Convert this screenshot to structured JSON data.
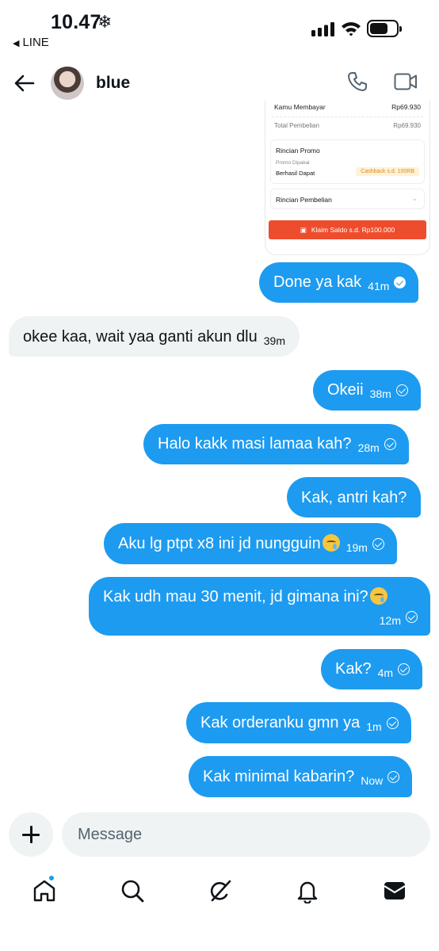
{
  "status_bar": {
    "time": "10.47",
    "weather_glyph": "❄",
    "back_app": "LINE",
    "back_glyph": "◀"
  },
  "header": {
    "username": "blue",
    "icons": [
      "back-arrow-icon",
      "avatar",
      "phone-icon",
      "video-icon"
    ]
  },
  "receipt": {
    "paid_label": "Kamu Membayar",
    "paid_value": "Rp69.930",
    "total_label": "Total Pembelian",
    "total_value": "Rp69.930",
    "promo_title": "Rincian Promo",
    "promo_used": "Promo Dipakai",
    "promo_got": "Berhasil Dapat",
    "promo_badge": "Cashback s.d. 100RB",
    "purchase_details": "Rincian Pembelian",
    "cta": "Klaim Saldo s.d. Rp100.000",
    "accent": "#ee4d2d"
  },
  "messages": [
    {
      "dir": "out",
      "text": "Done ya kak",
      "time": "41m",
      "status": "seen"
    },
    {
      "dir": "in",
      "text": "okee kaa, wait yaa ganti akun dlu",
      "time": "39m"
    },
    {
      "dir": "out",
      "text": "Okeii",
      "time": "38m",
      "status": "sent"
    },
    {
      "dir": "out",
      "text": "Halo kakk masi lamaa kah?",
      "time": "28m",
      "status": "sent"
    },
    {
      "dir": "out",
      "text": "Kak, antri kah?",
      "time": "",
      "status": ""
    },
    {
      "dir": "out",
      "text": "Aku lg ptpt x8 ini jd nungguin",
      "emoji": "face-holding-back-tears",
      "time": "19m",
      "status": "sent"
    },
    {
      "dir": "out",
      "text": "Kak udh mau 30 menit, jd gimana ini?",
      "emoji": "face-holding-back-tears",
      "time": "12m",
      "status": "sent"
    },
    {
      "dir": "out",
      "text": "Kak?",
      "time": "4m",
      "status": "sent"
    },
    {
      "dir": "out",
      "text": "Kak orderanku gmn ya",
      "time": "1m",
      "status": "sent"
    },
    {
      "dir": "out",
      "text": "Kak minimal kabarin?",
      "time": "Now",
      "status": "sent"
    }
  ],
  "composer": {
    "placeholder": "Message"
  },
  "bottom_nav": {
    "items": [
      "home-icon",
      "search-icon",
      "grok-icon",
      "notifications-icon",
      "messages-icon"
    ],
    "home_has_dot": true
  },
  "colors": {
    "outgoing_bubble": "#1d9bf0",
    "incoming_bubble": "#eff3f4",
    "text": "#0f1419"
  }
}
